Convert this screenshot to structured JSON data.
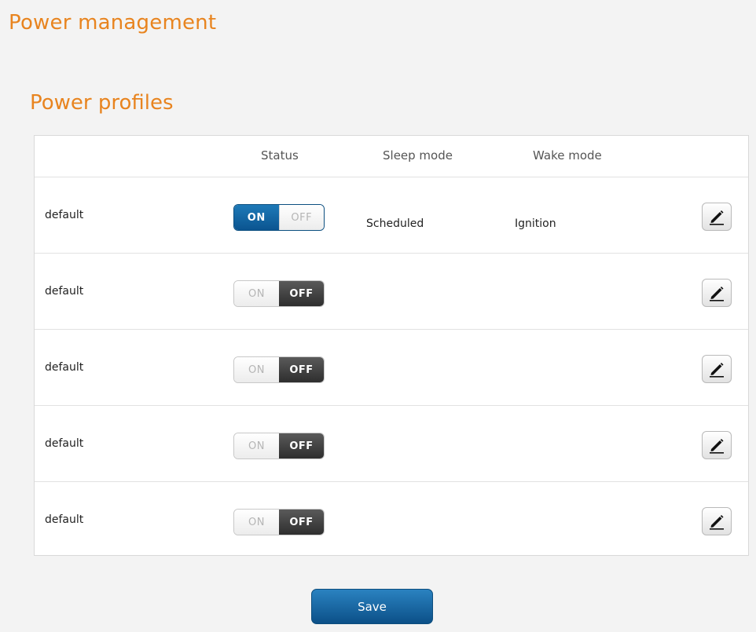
{
  "page": {
    "title": "Power management"
  },
  "section": {
    "title": "Power profiles"
  },
  "table": {
    "columns": {
      "status": "Status",
      "sleep_mode": "Sleep mode",
      "wake_mode": "Wake mode"
    },
    "rows": [
      {
        "name": "default",
        "status": "on",
        "sleep_mode": "Scheduled",
        "wake_mode": "Ignition"
      },
      {
        "name": "default",
        "status": "off",
        "sleep_mode": "",
        "wake_mode": ""
      },
      {
        "name": "default",
        "status": "off",
        "sleep_mode": "",
        "wake_mode": ""
      },
      {
        "name": "default",
        "status": "off",
        "sleep_mode": "",
        "wake_mode": ""
      },
      {
        "name": "default",
        "status": "off",
        "sleep_mode": "",
        "wake_mode": ""
      }
    ]
  },
  "toggle": {
    "on_label": "ON",
    "off_label": "OFF"
  },
  "edit_icon": "pencil-icon",
  "actions": {
    "save_label": "Save"
  },
  "colors": {
    "accent": "#e8841f",
    "toggle_on": "#0b5490",
    "toggle_off": "#2e2e2e",
    "button": "#1a6aa8"
  }
}
